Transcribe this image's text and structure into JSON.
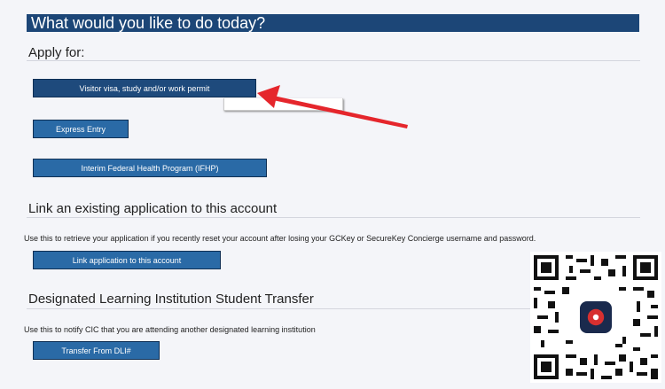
{
  "header": {
    "title": "What would you like to do today?"
  },
  "apply": {
    "title": "Apply for:",
    "buttons": [
      {
        "label": "Visitor visa, study and/or work permit"
      },
      {
        "label": "Express Entry"
      },
      {
        "label": "Interim Federal Health Program (IFHP)"
      }
    ]
  },
  "link": {
    "title": "Link an existing application to this account",
    "description": "Use this to retrieve your application if you recently reset your account after losing your GCKey or SecureKey Concierge username and password.",
    "button": "Link application to this account"
  },
  "dli": {
    "title": "Designated Learning Institution Student Transfer",
    "description": "Use this to notify CIC that you are attending another designated learning institution",
    "button": "Transfer From DLI#"
  },
  "colors": {
    "banner": "#1c4677",
    "button": "#2a6aa6",
    "arrow": "#e5262c"
  },
  "icons": [
    "arrow-annotation",
    "qr-code"
  ]
}
